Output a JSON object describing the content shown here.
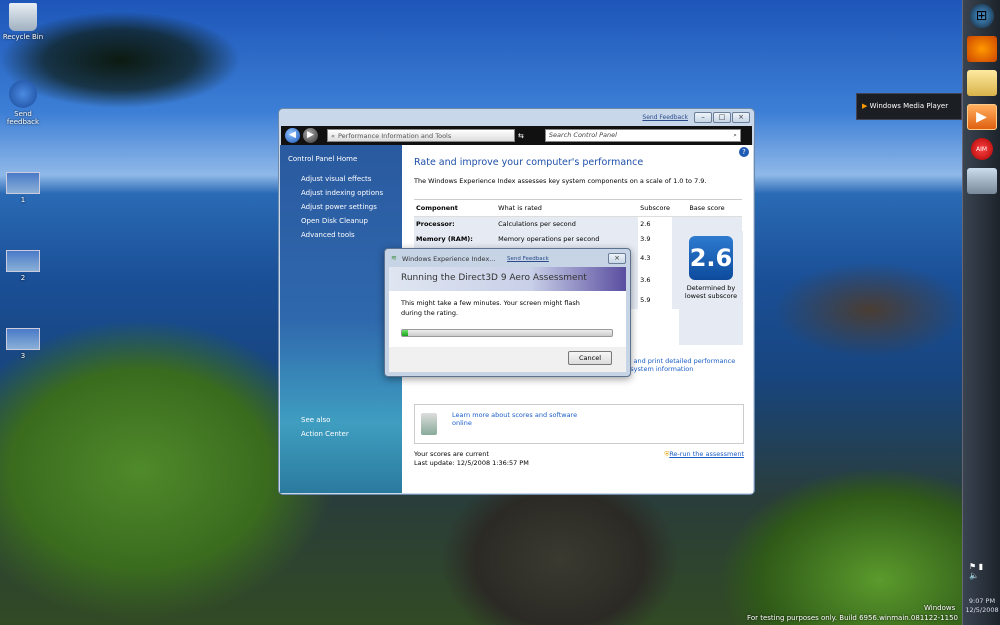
{
  "desktop": {
    "icons": [
      {
        "label": "Recycle Bin"
      },
      {
        "label": "Send feedback"
      },
      {
        "label": "1"
      },
      {
        "label": "2"
      },
      {
        "label": "3"
      }
    ],
    "watermark": {
      "line1": "Windows",
      "line2": "For testing purposes only. Build 6956.winmain.081122-1150"
    }
  },
  "window": {
    "send_feedback": "Send Feedback",
    "address": "Performance Information and Tools",
    "search_placeholder": "Search Control Panel",
    "sidebar": {
      "home": "Control Panel Home",
      "items": [
        "Adjust visual effects",
        "Adjust indexing options",
        "Adjust power settings",
        "Open Disk Cleanup",
        "Advanced tools"
      ],
      "see_also": "See also",
      "action_center": "Action Center"
    },
    "main": {
      "title": "Rate and improve your computer's performance",
      "intro": "The Windows Experience Index assesses key system components on a scale of 1.0 to 7.9.",
      "headers": [
        "Component",
        "What is rated",
        "Subscore",
        "Base score"
      ],
      "rows": [
        {
          "component": "Processor:",
          "rated": "Calculations per second",
          "subscore": "2.6"
        },
        {
          "component": "Memory (RAM):",
          "rated": "Memory operations per second",
          "subscore": "3.9"
        },
        {
          "component": "",
          "rated": "",
          "subscore": "4.3"
        },
        {
          "component": "",
          "rated": "",
          "subscore": "3.6"
        },
        {
          "component": "",
          "rated": "",
          "subscore": "5.9"
        }
      ],
      "base_score": "2.6",
      "base_caption": "Determined by lowest subscore",
      "print_link": "View and print detailed performance and system information",
      "learn_link": "Learn more about scores and software online",
      "status": "Your scores are current",
      "last_update": "Last update: 12/5/2008 1:36:57 PM",
      "rerun": "Re-run the assessment"
    }
  },
  "dialog": {
    "title": "Windows Experience Index...",
    "send_feedback": "Send Feedback",
    "heading": "Running the Direct3D 9 Aero Assessment",
    "message": "This might take a few minutes. Your screen might flash during the rating.",
    "progress_percent": 3,
    "cancel": "Cancel"
  },
  "taskbar": {
    "tooltip": "Windows Media Player",
    "time": "9:07 PM",
    "date": "12/5/2008"
  }
}
